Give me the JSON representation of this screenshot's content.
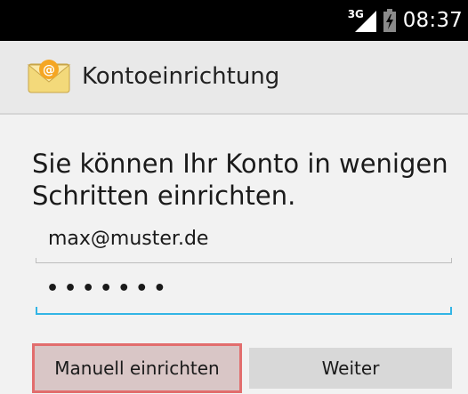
{
  "status_bar": {
    "network_type": "3G",
    "time": "08:37",
    "icons": [
      "signal-icon",
      "battery-icon"
    ]
  },
  "action_bar": {
    "app_icon": "email-app-icon",
    "title": "Kontoeinrichtung"
  },
  "content": {
    "intro_text": "Sie können Ihr Konto in wenigen Schritten einrichten.",
    "email_value": "max@muster.de",
    "password_value": "•••••••"
  },
  "buttons": {
    "manual_label": "Manuell einrichten",
    "next_label": "Weiter"
  },
  "colors": {
    "status_bar": "#000000",
    "action_bar": "#e9e9e9",
    "accent": "#33b5e5",
    "highlight_border": "#e26d6d",
    "highlight_fill": "#d9c6c6"
  }
}
